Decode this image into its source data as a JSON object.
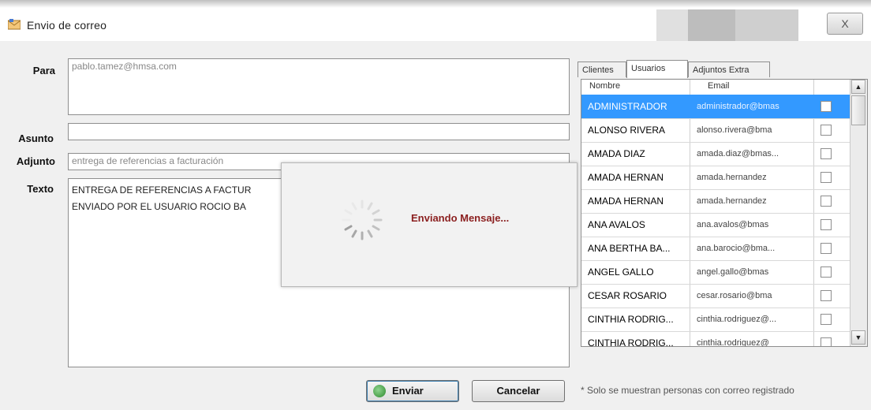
{
  "window": {
    "title": "Envio de correo",
    "close_label": "X"
  },
  "form": {
    "para_label": "Para",
    "para_value": "pablo.tamez@hmsa.com",
    "asunto_label": "Asunto",
    "asunto_value": "",
    "adjunto_label": "Adjunto",
    "adjunto_value": "entrega de referencias a facturación",
    "texto_label": "Texto",
    "texto_lines": [
      "ENTREGA DE REFERENCIAS A FACTUR",
      "ENVIADO POR EL USUARIO ROCIO BA"
    ]
  },
  "tabs": [
    {
      "label": "Clientes",
      "active": false
    },
    {
      "label": "Usuarios",
      "active": true
    },
    {
      "label": "Adjuntos Extra",
      "active": false
    }
  ],
  "grid": {
    "columns": [
      "Nombre",
      "Email"
    ],
    "rows": [
      {
        "name": "ADMINISTRADOR",
        "email": "administrador@bmas",
        "selected": true
      },
      {
        "name": "ALONSO RIVERA",
        "email": "alonso.rivera@bma",
        "selected": false
      },
      {
        "name": "AMADA DIAZ",
        "email": "amada.diaz@bmas...",
        "selected": false
      },
      {
        "name": "AMADA HERNAN",
        "email": "amada.hernandez",
        "selected": false
      },
      {
        "name": "AMADA HERNAN",
        "email": "amada.hernandez",
        "selected": false
      },
      {
        "name": "ANA AVALOS",
        "email": "ana.avalos@bmas",
        "selected": false
      },
      {
        "name": "ANA BERTHA BA...",
        "email": "ana.barocio@bma...",
        "selected": false
      },
      {
        "name": "ANGEL GALLO",
        "email": "angel.gallo@bmas",
        "selected": false
      },
      {
        "name": "CESAR ROSARIO",
        "email": "cesar.rosario@bma",
        "selected": false
      },
      {
        "name": "CINTHIA RODRIG...",
        "email": "cinthia.rodriguez@...",
        "selected": false
      },
      {
        "name": "CINTHIA RODRIG...",
        "email": "cinthia.rodriguez@",
        "selected": false
      }
    ]
  },
  "buttons": {
    "enviar": "Enviar",
    "cancelar": "Cancelar"
  },
  "note": "* Solo se muestran personas con correo registrado",
  "modal": {
    "message": "Enviando Mensaje..."
  },
  "colors": {
    "selection": "#3399ff",
    "dialog_bg": "#f0f0f0",
    "modal_text": "#8b1f1f"
  }
}
